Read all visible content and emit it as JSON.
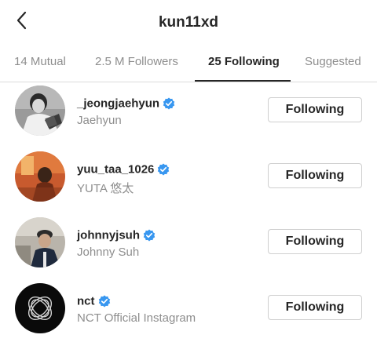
{
  "header": {
    "title": "kun11xd",
    "back_icon": "chevron-left-icon"
  },
  "tabs": [
    {
      "label": "14 Mutual",
      "active": false
    },
    {
      "label": "2.5 M Followers",
      "active": false
    },
    {
      "label": "25 Following",
      "active": true
    },
    {
      "label": "Suggested",
      "active": false
    }
  ],
  "users": [
    {
      "username": "_jeongjaehyun",
      "full_name": "Jaehyun",
      "verified": true,
      "button": "Following"
    },
    {
      "username": "yuu_taa_1026",
      "full_name": "YUTA 悠太",
      "verified": true,
      "button": "Following"
    },
    {
      "username": "johnnyjsuh",
      "full_name": "Johnny Suh",
      "verified": true,
      "button": "Following"
    },
    {
      "username": "nct",
      "full_name": "NCT Official Instagram",
      "verified": true,
      "button": "Following"
    }
  ],
  "colors": {
    "verified": "#3897f0",
    "secondary_text": "#8e8e8e",
    "primary_text": "#262626",
    "divider": "#dbdbdb"
  }
}
